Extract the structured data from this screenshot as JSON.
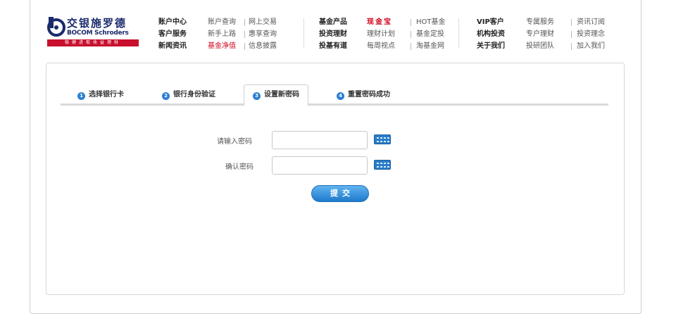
{
  "logo": {
    "cn": "交银施罗德",
    "en": "BOCOM Schroders",
    "slogan": "稳健进取收益理财"
  },
  "nav": {
    "col1": [
      {
        "text": "账户中心",
        "style": "bold"
      },
      {
        "text": "客户服务",
        "style": "bold"
      },
      {
        "text": "新闻资讯",
        "style": "bold"
      }
    ],
    "col2": [
      {
        "text": "账户查询",
        "style": "normal"
      },
      {
        "text": "新手上路",
        "style": "normal"
      },
      {
        "text": "基金净值",
        "style": "red"
      }
    ],
    "col3": [
      {
        "text": "网上交易",
        "style": "normal"
      },
      {
        "text": "惠享查询",
        "style": "normal"
      },
      {
        "text": "信息披露",
        "style": "normal"
      }
    ],
    "col4": [
      {
        "text": "基金产品",
        "style": "bold"
      },
      {
        "text": "投资理财",
        "style": "bold"
      },
      {
        "text": "投基有道",
        "style": "bold"
      }
    ],
    "col5": [
      {
        "text": "现金宝",
        "style": "redbold"
      },
      {
        "text": "理财计划",
        "style": "normal"
      },
      {
        "text": "每周视点",
        "style": "normal"
      }
    ],
    "col6": [
      {
        "text": "HOT基金",
        "style": "normal"
      },
      {
        "text": "基金定投",
        "style": "normal"
      },
      {
        "text": "淘基金网",
        "style": "normal"
      }
    ],
    "col7": [
      {
        "text": "VIP客户",
        "style": "bold"
      },
      {
        "text": "机构投资",
        "style": "bold"
      },
      {
        "text": "关于我们",
        "style": "bold"
      }
    ],
    "col8": [
      {
        "text": "专属服务",
        "style": "normal"
      },
      {
        "text": "专户理财",
        "style": "normal"
      },
      {
        "text": "投研团队",
        "style": "normal"
      }
    ],
    "col9": [
      {
        "text": "资讯订阅",
        "style": "normal"
      },
      {
        "text": "投资理念",
        "style": "normal"
      },
      {
        "text": "加入我们",
        "style": "normal"
      }
    ]
  },
  "tabs": [
    {
      "num": "1",
      "label": "选择银行卡"
    },
    {
      "num": "2",
      "label": "银行身份验证"
    },
    {
      "num": "3",
      "label": "设置新密码"
    },
    {
      "num": "4",
      "label": "重置密码成功"
    }
  ],
  "form": {
    "password_label": "请输入密码",
    "password_value": "",
    "confirm_label": "确认密码",
    "confirm_value": "",
    "submit_label": "提交"
  },
  "colors": {
    "brand_blue": "#1b2a6b",
    "brand_red": "#c8102e",
    "accent_blue": "#2b7fd3"
  }
}
